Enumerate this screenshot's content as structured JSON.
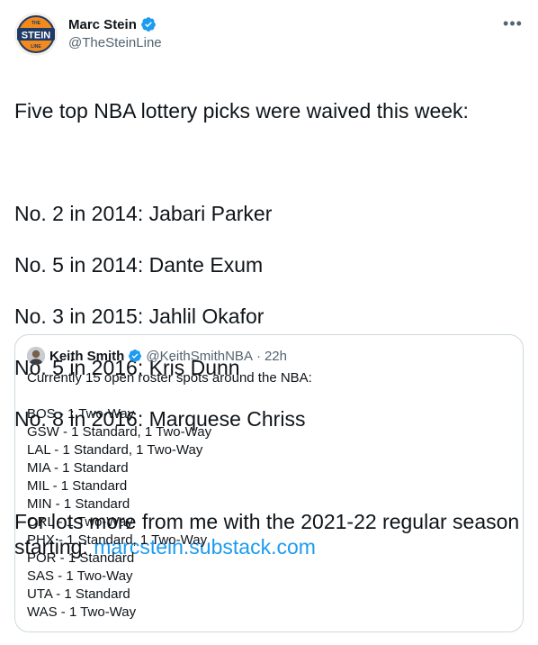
{
  "author": {
    "display_name": "Marc Stein",
    "handle": "@TheSteinLine",
    "avatar_text_top": "THE",
    "avatar_text_main": "STEIN",
    "avatar_text_bottom": "LINE"
  },
  "tweet": {
    "intro": "Five top NBA lottery picks were waived this week:",
    "picks": [
      "No. 2 in 2014: Jabari Parker",
      "No. 5 in 2014: Dante Exum",
      "No. 3 in 2015: Jahlil Okafor",
      "No. 5 in 2016: Kris Dunn",
      "No. 8 in 2016: Marquese Chriss"
    ],
    "outro": "For lots more from me with the 2021-22 regular season starting: ",
    "link": "marcstein.substack.com"
  },
  "quote": {
    "display_name": "Keith Smith",
    "handle": "@KeithSmithNBA",
    "separator": "·",
    "time": "22h",
    "intro": "Currently 15 open roster spots around the NBA:",
    "lines": [
      "BOS - 1 Two-Way",
      "GSW - 1 Standard, 1 Two-Way",
      "LAL - 1 Standard, 1 Two-Way",
      "MIA - 1 Standard",
      "MIL - 1 Standard",
      "MIN - 1 Standard",
      "ORL - 1 Two-Way",
      "PHX - 1 Standard, 1 Two-Way",
      "POR - 1 Standard",
      "SAS - 1 Two-Way",
      "UTA - 1 Standard",
      "WAS - 1 Two-Way"
    ]
  },
  "icons": {
    "verified": "verified-badge-icon",
    "more": "more-options-icon"
  },
  "colors": {
    "accent": "#1d9bf0",
    "text": "#0f1419",
    "secondary": "#536471",
    "border": "#cfd9de",
    "avatar_orange": "#f28a1e",
    "avatar_navy": "#1e3a66"
  }
}
